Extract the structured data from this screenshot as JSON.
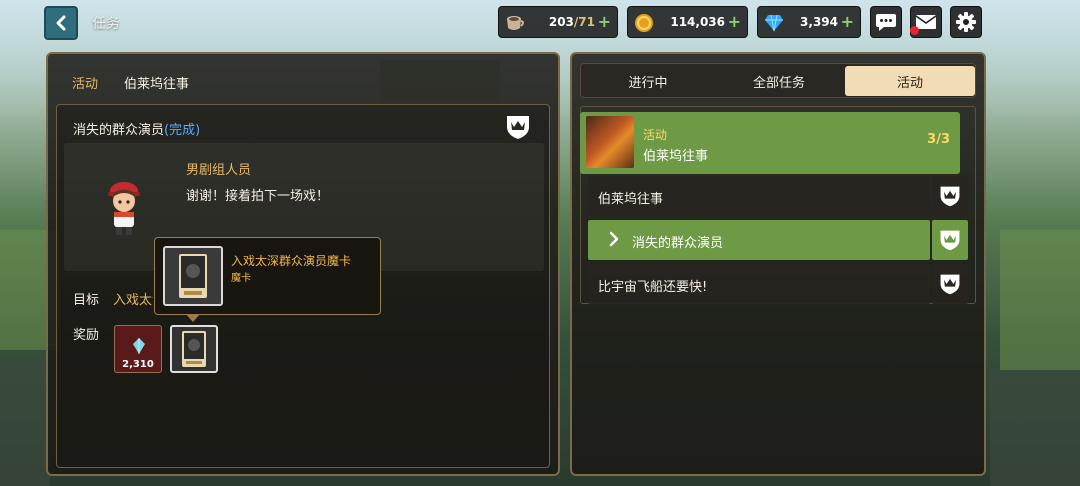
{
  "header": {
    "back_icon": "chevron-left-icon",
    "title": "任务",
    "resources": {
      "stamina": {
        "icon": "coffee-cup-icon",
        "value": "203",
        "max": "/71"
      },
      "gold": {
        "icon": "gold-coin-icon",
        "value": "114,036"
      },
      "gems": {
        "icon": "diamond-icon",
        "value": "3,394"
      }
    },
    "buttons": [
      "chat-bubble-icon",
      "mail-icon",
      "gear-icon"
    ]
  },
  "left_panel": {
    "breadcrumb": "活动",
    "title": "伯莱坞往事",
    "quest": {
      "name": "消失的群众演员",
      "status": "(完成)",
      "npc_name": "男剧组人员",
      "npc_line": "谢谢！接着拍下一场戏！",
      "goal_label": "目标",
      "goal_value": "入戏太深",
      "reward_label": "奖励",
      "rewards": [
        {
          "type": "gem",
          "amount": "2,310"
        },
        {
          "type": "card"
        }
      ]
    },
    "tooltip": {
      "title": "入戏太深群众演员魔卡",
      "subtitle": "魔卡"
    }
  },
  "right_panel": {
    "tabs": [
      "进行中",
      "全部任务",
      "活动"
    ],
    "active_tab": 2,
    "group": {
      "category": "活动",
      "name": "伯莱坞往事",
      "progress": "3/3"
    },
    "quests": [
      {
        "label": "伯莱坞往事",
        "active": false
      },
      {
        "label": "消失的群众演员",
        "active": true
      },
      {
        "label": "比宇宙飞船还要快!",
        "active": false
      }
    ]
  },
  "colors": {
    "accent_gold": "#e6b86a",
    "active_green": "#6f9a45",
    "tab_active": "#f2dcb5",
    "complete_blue": "#5fa8ff",
    "notification_red": "#e8242f"
  }
}
